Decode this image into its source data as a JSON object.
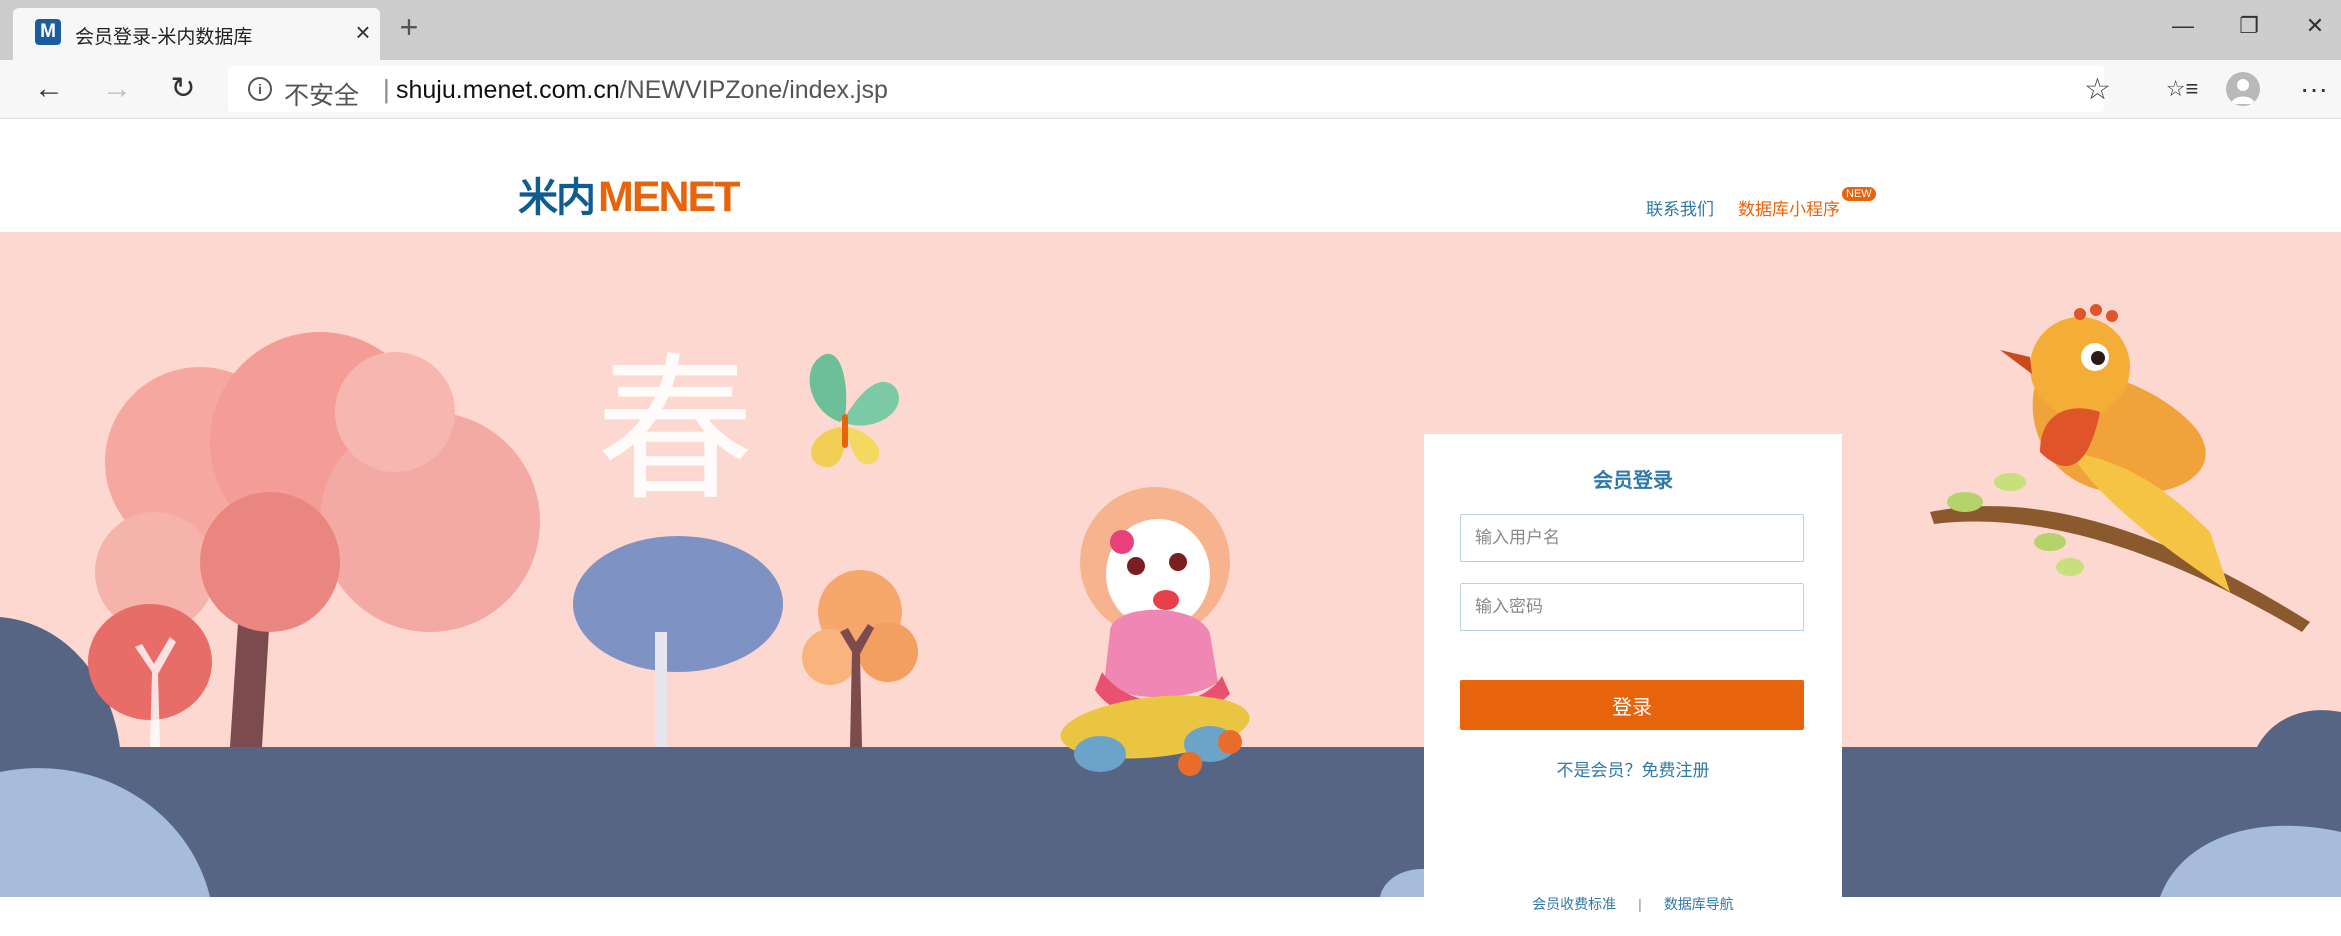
{
  "browser": {
    "tab_title": "会员登录-米内数据库",
    "favicon_letter": "M",
    "close_glyph": "×",
    "new_tab_glyph": "+",
    "minimize_glyph": "—",
    "restore_glyph": "❐",
    "window_close_glyph": "✕",
    "back_glyph": "←",
    "forward_glyph": "→",
    "refresh_glyph": "↻",
    "info_glyph": "i",
    "security_text": "不安全",
    "url_separator": "|",
    "url_host": "shuju.menet.com.cn",
    "url_path": "/NEWVIPZone/index.jsp",
    "favorite_glyph": "☆",
    "favorites_list_glyph": "☆≡",
    "more_glyph": "···"
  },
  "header": {
    "logo_cn": "米内",
    "logo_en": "MENET",
    "contact_label": "联系我们",
    "miniprogram_label": "数据库小程序",
    "new_badge": "NEW"
  },
  "banner": {
    "spring_char": "春"
  },
  "login": {
    "title": "会员登录",
    "username_placeholder": "输入用户名",
    "password_placeholder": "输入密码",
    "login_button": "登录",
    "register_link": "不是会员？免费注册",
    "pricing_link": "会员收费标准",
    "footer_sep": "|",
    "directory_link": "数据库导航"
  },
  "colors": {
    "brand_orange": "#e8640c",
    "brand_blue": "#0f5d8f",
    "link_blue": "#2f79a8",
    "banner_pink": "#fdd8d0",
    "ground_slate": "#566583"
  }
}
